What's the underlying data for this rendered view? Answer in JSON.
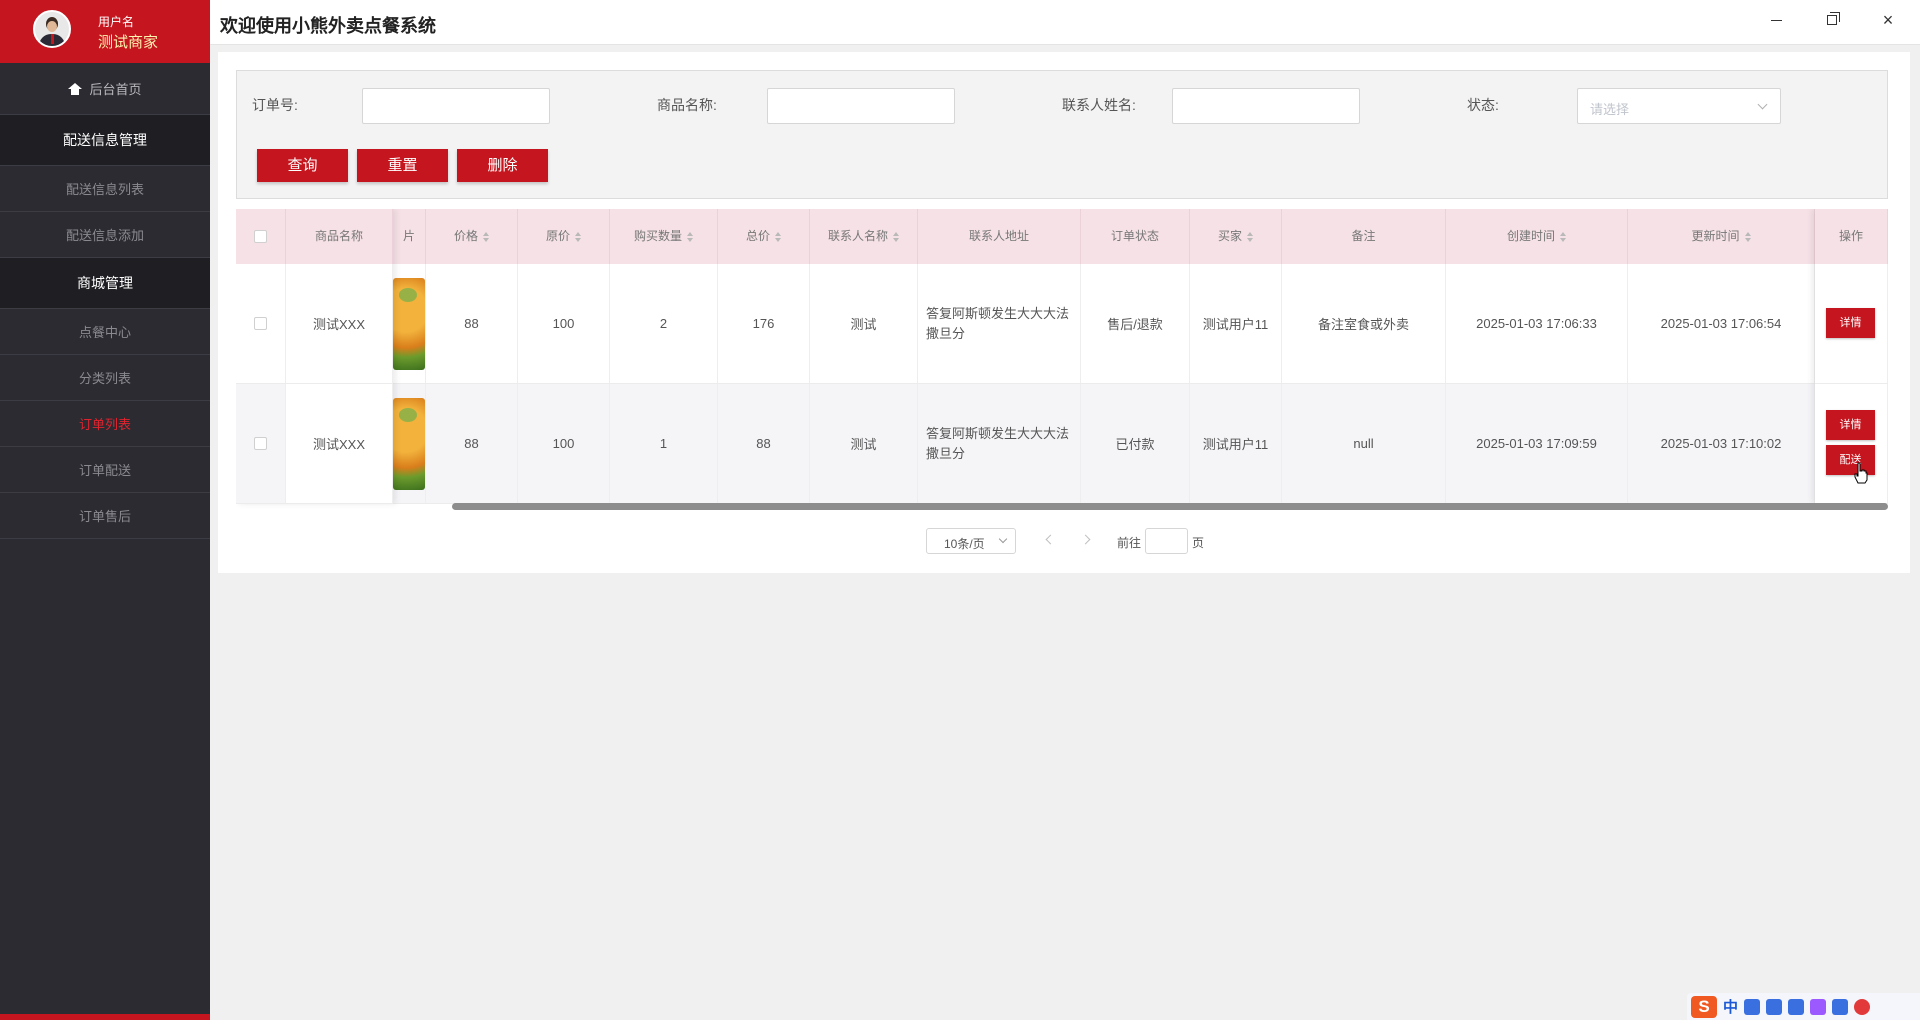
{
  "user": {
    "label": "用户名",
    "name": "测试商家"
  },
  "sidebar": {
    "home": "后台首页",
    "groups": [
      {
        "label": "配送信息管理",
        "items": [
          "配送信息列表",
          "配送信息添加"
        ]
      },
      {
        "label": "商城管理",
        "items": [
          "点餐中心",
          "分类列表",
          "订单列表",
          "订单配送",
          "订单售后"
        ]
      }
    ],
    "active_item": "订单列表",
    "active_color": "#e0242f"
  },
  "header": {
    "title": "欢迎使用小熊外卖点餐系统"
  },
  "window_controls": {
    "minimize": "minimize-icon",
    "maximize": "restore-icon",
    "close": "×"
  },
  "filters": {
    "order_no_label": "订单号:",
    "goods_name_label": "商品名称:",
    "contact_name_label": "联系人姓名:",
    "status_label": "状态:",
    "status_placeholder": "请选择"
  },
  "actions": {
    "query": "查询",
    "reset": "重置",
    "delete": "删除"
  },
  "table": {
    "columns": {
      "goods_name": "商品名称",
      "image_partial": "片",
      "price": "价格",
      "original_price": "原价",
      "quantity": "购买数量",
      "total": "总价",
      "contact_name": "联系人名称",
      "contact_address": "联系人地址",
      "order_status": "订单状态",
      "buyer": "买家",
      "remark": "备注",
      "created_at": "创建时间",
      "updated_at": "更新时间",
      "operation": "操作"
    },
    "rows": [
      {
        "goods_name": "测试XXX",
        "price": "88",
        "original_price": "100",
        "quantity": "2",
        "total": "176",
        "contact_name": "测试",
        "contact_address": "答复阿斯顿发生大大大法撒旦分",
        "order_status": "售后/退款",
        "buyer": "测试用户11",
        "remark": "备注室食或外卖",
        "created_at": "2025-01-03 17:06:33",
        "updated_at": "2025-01-03 17:06:54",
        "buttons": [
          "详情"
        ]
      },
      {
        "goods_name": "测试XXX",
        "price": "88",
        "original_price": "100",
        "quantity": "1",
        "total": "88",
        "contact_name": "测试",
        "contact_address": "答复阿斯顿发生大大大法撒旦分",
        "order_status": "已付款",
        "buyer": "测试用户11",
        "remark": "null",
        "created_at": "2025-01-03 17:09:59",
        "updated_at": "2025-01-03 17:10:02",
        "buttons": [
          "详情",
          "配送"
        ]
      }
    ]
  },
  "pagination": {
    "page_size": "10条/页",
    "goto_label": "前往",
    "page_suffix": "页",
    "goto_value": ""
  },
  "ime": {
    "logo": "S",
    "mode": "中"
  },
  "colors": {
    "brand": "#c5161f",
    "sidebar_bg": "#2b2b31",
    "header_row_bg": "#f5e1e6"
  }
}
